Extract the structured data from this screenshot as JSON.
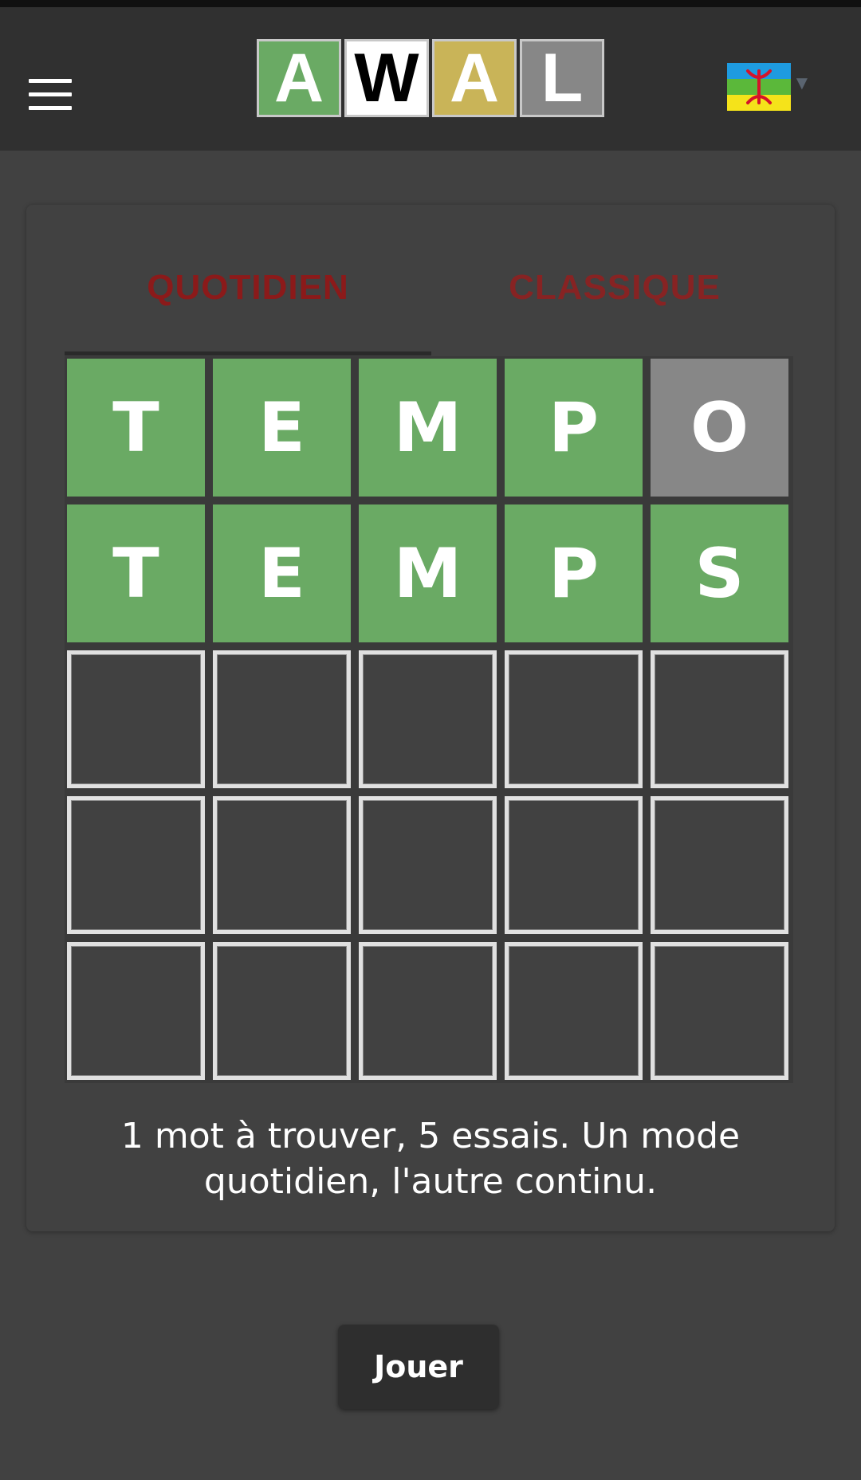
{
  "header": {
    "logo_letters": [
      {
        "letter": "A",
        "bg": "#6aaa64",
        "fg": "#ffffff"
      },
      {
        "letter": "W",
        "bg": "#ffffff",
        "fg": "#000000"
      },
      {
        "letter": "A",
        "bg": "#c9b458",
        "fg": "#ffffff"
      },
      {
        "letter": "L",
        "bg": "#878787",
        "fg": "#ffffff"
      }
    ],
    "menu_icon": "hamburger-menu-icon",
    "language_flag": "amazigh-flag-icon",
    "language_caret": "▼"
  },
  "tabs": [
    {
      "label": "QUOTIDIEN",
      "active": true
    },
    {
      "label": "CLASSIQUE",
      "active": false
    }
  ],
  "colors": {
    "correct": "#6aaa64",
    "absent": "#878787",
    "tab_text": "#8b1a1a"
  },
  "board": [
    [
      {
        "letter": "T",
        "state": "correct"
      },
      {
        "letter": "E",
        "state": "correct"
      },
      {
        "letter": "M",
        "state": "correct"
      },
      {
        "letter": "P",
        "state": "correct"
      },
      {
        "letter": "O",
        "state": "absent"
      }
    ],
    [
      {
        "letter": "T",
        "state": "correct"
      },
      {
        "letter": "E",
        "state": "correct"
      },
      {
        "letter": "M",
        "state": "correct"
      },
      {
        "letter": "P",
        "state": "correct"
      },
      {
        "letter": "S",
        "state": "correct"
      }
    ],
    [
      {
        "letter": "",
        "state": "empty"
      },
      {
        "letter": "",
        "state": "empty"
      },
      {
        "letter": "",
        "state": "empty"
      },
      {
        "letter": "",
        "state": "empty"
      },
      {
        "letter": "",
        "state": "empty"
      }
    ],
    [
      {
        "letter": "",
        "state": "empty"
      },
      {
        "letter": "",
        "state": "empty"
      },
      {
        "letter": "",
        "state": "empty"
      },
      {
        "letter": "",
        "state": "empty"
      },
      {
        "letter": "",
        "state": "empty"
      }
    ],
    [
      {
        "letter": "",
        "state": "empty"
      },
      {
        "letter": "",
        "state": "empty"
      },
      {
        "letter": "",
        "state": "empty"
      },
      {
        "letter": "",
        "state": "empty"
      },
      {
        "letter": "",
        "state": "empty"
      }
    ]
  ],
  "description": "1 mot à trouver, 5 essais. Un mode quotidien, l'autre continu.",
  "play_button_label": "Jouer"
}
